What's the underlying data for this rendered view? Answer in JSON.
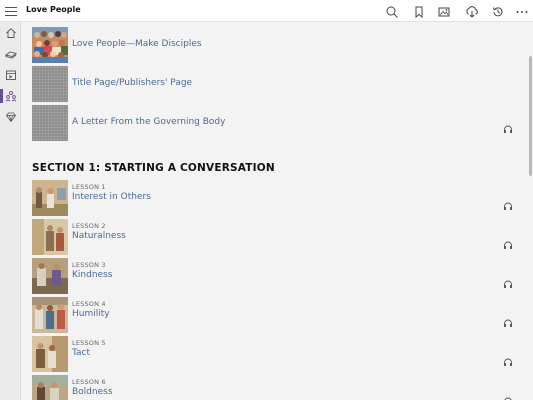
{
  "app": {
    "title": "Love People"
  },
  "titlebar": {
    "icons": [
      "search-icon",
      "bookmark-icon",
      "image-gallery-icon",
      "download-icon",
      "history-icon",
      "more-icon"
    ]
  },
  "sidebar": {
    "items": [
      {
        "icon": "home-icon",
        "active": false
      },
      {
        "icon": "bible-icon",
        "active": false
      },
      {
        "icon": "publications-icon",
        "active": false
      },
      {
        "icon": "meetings-icon",
        "active": true
      },
      {
        "icon": "gem-icon",
        "active": false
      }
    ],
    "accent_color": "#6a4c9c"
  },
  "intro": [
    {
      "title": "Love People—Make Disciples",
      "thumb": "cover",
      "audio": false
    },
    {
      "title": "Title Page/Publishers' Page",
      "thumb": "placeholder",
      "audio": false
    },
    {
      "title": "A Letter From the Governing Body",
      "thumb": "placeholder",
      "audio": true
    }
  ],
  "section": {
    "title": "SECTION 1: STARTING A CONVERSATION"
  },
  "lessons": [
    {
      "number": "LESSON 1",
      "title": "Interest in Others"
    },
    {
      "number": "LESSON 2",
      "title": "Naturalness"
    },
    {
      "number": "LESSON 3",
      "title": "Kindness"
    },
    {
      "number": "LESSON 4",
      "title": "Humility"
    },
    {
      "number": "LESSON 5",
      "title": "Tact"
    },
    {
      "number": "LESSON 6",
      "title": "Boldness"
    }
  ],
  "colors": {
    "link": "#4a6a96",
    "background": "#f3f3f3"
  }
}
